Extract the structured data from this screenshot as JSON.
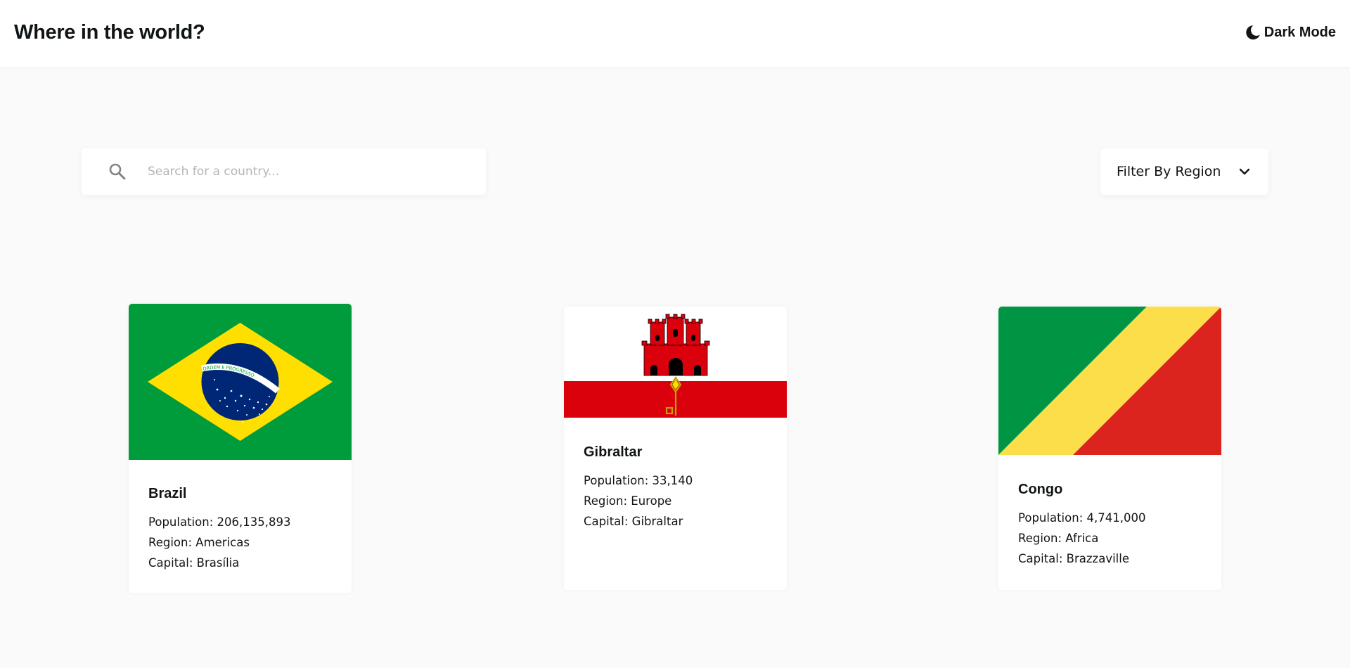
{
  "header": {
    "title": "Where in the world?",
    "dark_mode_label": "Dark Mode",
    "dark_mode_icon": "moon-icon"
  },
  "search": {
    "placeholder": "Search for a country...",
    "value": "",
    "icon": "search-icon"
  },
  "filter": {
    "label": "Filter By Region",
    "icon": "chevron-down-icon"
  },
  "labels": {
    "population": "Population:",
    "region": "Region:",
    "capital": "Capital:"
  },
  "countries": [
    {
      "name": "Brazil",
      "population": "206,135,893",
      "region": "Americas",
      "capital": "Brasília",
      "motto": "ORDEM E PROGRESSO"
    },
    {
      "name": "Gibraltar",
      "population": "33,140",
      "region": "Europe",
      "capital": "Gibraltar"
    },
    {
      "name": "Congo",
      "population": "4,741,000",
      "region": "Africa",
      "capital": "Brazzaville"
    }
  ],
  "colors": {
    "background": "#fafafa",
    "surface": "#ffffff",
    "text": "#111517",
    "placeholder": "#b5b5b5",
    "brazil_green": "#009b3a",
    "brazil_yellow": "#fedf00",
    "brazil_blue": "#002776",
    "gibraltar_red": "#da000c",
    "congo_green": "#009543",
    "congo_yellow": "#fbde4a",
    "congo_red": "#dc241f"
  }
}
